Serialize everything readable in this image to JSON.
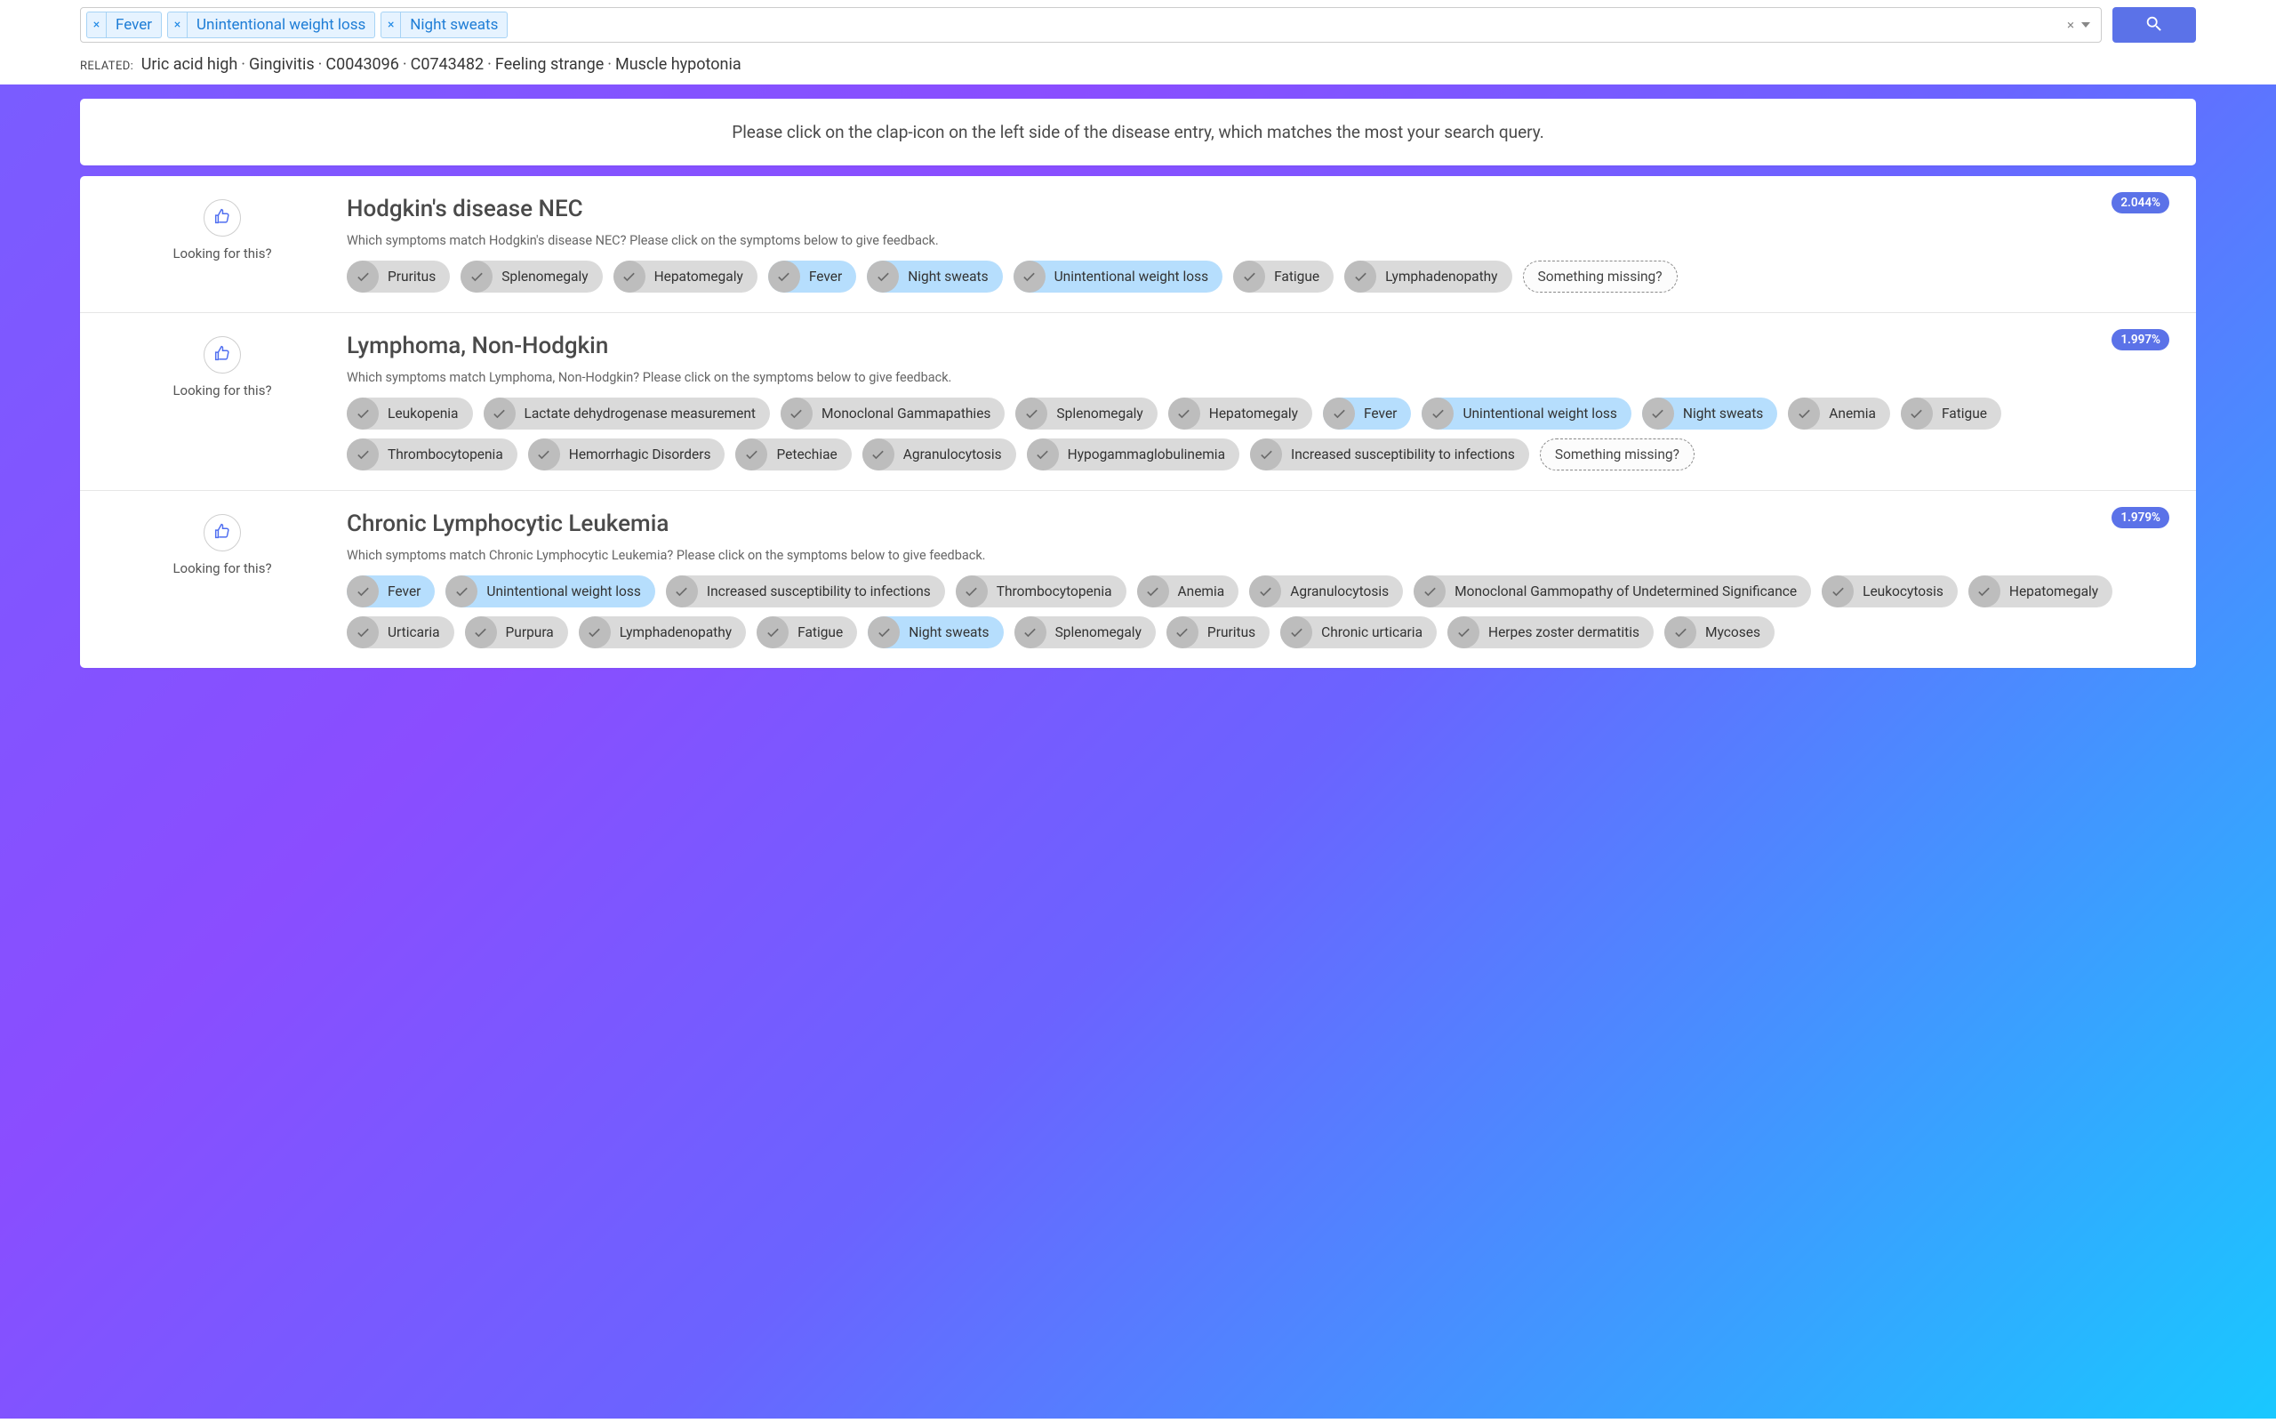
{
  "search": {
    "chips": [
      "Fever",
      "Unintentional weight loss",
      "Night sweats"
    ]
  },
  "related": {
    "label": "RELATED:",
    "items": [
      "Uric acid high",
      "Gingivitis",
      "C0043096",
      "C0743482",
      "Feeling strange",
      "Muscle hypotonia"
    ]
  },
  "instruction": "Please click on the clap-icon on the left side of the disease entry, which matches the most your search query.",
  "clap_label": "Looking for this?",
  "missing_label": "Something missing?",
  "results": [
    {
      "title": "Hodgkin's disease NEC",
      "percent": "2.044%",
      "feedback_prompt": "Which symptoms match Hodgkin's disease NEC? Please click on the symptoms below to give feedback.",
      "symptoms": [
        {
          "label": "Pruritus",
          "highlight": false
        },
        {
          "label": "Splenomegaly",
          "highlight": false
        },
        {
          "label": "Hepatomegaly",
          "highlight": false
        },
        {
          "label": "Fever",
          "highlight": true
        },
        {
          "label": "Night sweats",
          "highlight": true
        },
        {
          "label": "Unintentional weight loss",
          "highlight": true
        },
        {
          "label": "Fatigue",
          "highlight": false
        },
        {
          "label": "Lymphadenopathy",
          "highlight": false
        }
      ],
      "show_missing": true
    },
    {
      "title": "Lymphoma, Non-Hodgkin",
      "percent": "1.997%",
      "feedback_prompt": "Which symptoms match Lymphoma, Non-Hodgkin? Please click on the symptoms below to give feedback.",
      "symptoms": [
        {
          "label": "Leukopenia",
          "highlight": false
        },
        {
          "label": "Lactate dehydrogenase measurement",
          "highlight": false
        },
        {
          "label": "Monoclonal Gammapathies",
          "highlight": false
        },
        {
          "label": "Splenomegaly",
          "highlight": false
        },
        {
          "label": "Hepatomegaly",
          "highlight": false
        },
        {
          "label": "Fever",
          "highlight": true
        },
        {
          "label": "Unintentional weight loss",
          "highlight": true
        },
        {
          "label": "Night sweats",
          "highlight": true
        },
        {
          "label": "Anemia",
          "highlight": false
        },
        {
          "label": "Fatigue",
          "highlight": false
        },
        {
          "label": "Thrombocytopenia",
          "highlight": false
        },
        {
          "label": "Hemorrhagic Disorders",
          "highlight": false
        },
        {
          "label": "Petechiae",
          "highlight": false
        },
        {
          "label": "Agranulocytosis",
          "highlight": false
        },
        {
          "label": "Hypogammaglobulinemia",
          "highlight": false
        },
        {
          "label": "Increased susceptibility to infections",
          "highlight": false
        }
      ],
      "show_missing": true
    },
    {
      "title": "Chronic Lymphocytic Leukemia",
      "percent": "1.979%",
      "feedback_prompt": "Which symptoms match Chronic Lymphocytic Leukemia? Please click on the symptoms below to give feedback.",
      "symptoms": [
        {
          "label": "Fever",
          "highlight": true
        },
        {
          "label": "Unintentional weight loss",
          "highlight": true
        },
        {
          "label": "Increased susceptibility to infections",
          "highlight": false
        },
        {
          "label": "Thrombocytopenia",
          "highlight": false
        },
        {
          "label": "Anemia",
          "highlight": false
        },
        {
          "label": "Agranulocytosis",
          "highlight": false
        },
        {
          "label": "Monoclonal Gammopathy of Undetermined Significance",
          "highlight": false
        },
        {
          "label": "Leukocytosis",
          "highlight": false
        },
        {
          "label": "Hepatomegaly",
          "highlight": false
        },
        {
          "label": "Urticaria",
          "highlight": false
        },
        {
          "label": "Purpura",
          "highlight": false
        },
        {
          "label": "Lymphadenopathy",
          "highlight": false
        },
        {
          "label": "Fatigue",
          "highlight": false
        },
        {
          "label": "Night sweats",
          "highlight": true
        },
        {
          "label": "Splenomegaly",
          "highlight": false
        },
        {
          "label": "Pruritus",
          "highlight": false
        },
        {
          "label": "Chronic urticaria",
          "highlight": false
        },
        {
          "label": "Herpes zoster dermatitis",
          "highlight": false
        },
        {
          "label": "Mycoses",
          "highlight": false
        }
      ],
      "show_missing": false
    }
  ]
}
